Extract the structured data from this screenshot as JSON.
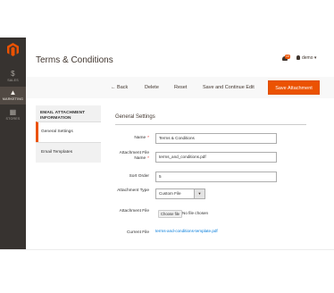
{
  "sidebar": {
    "items": [
      {
        "label": "SALES",
        "icon": "dollar-icon"
      },
      {
        "label": "MARKETING",
        "icon": "megaphone-icon"
      },
      {
        "label": "STORES",
        "icon": "store-icon"
      }
    ]
  },
  "header": {
    "title": "Terms & Conditions",
    "notification_count": "10",
    "user": "demo ▾"
  },
  "actions": {
    "back": "Back",
    "delete": "Delete",
    "reset": "Reset",
    "save_continue": "Save and Continue Edit",
    "save": "Save Attachment"
  },
  "tabs": {
    "title": "EMAIL ATTACHMENT INFORMATION",
    "items": [
      "General Settings",
      "Email Templates"
    ]
  },
  "form": {
    "section_title": "General Settings",
    "name_label": "Name",
    "name_value": "Terms & Conditions",
    "file_name_label": "Attachment File Name",
    "file_name_value": "terms_and_conditions.pdf",
    "sort_order_label": "Sort Order",
    "sort_order_value": "5",
    "type_label": "Attachment Type",
    "type_value": "Custom File",
    "file_label": "Attachment File",
    "choose_file": "Choose file",
    "no_file": "No file chosen",
    "current_file_label": "Current File",
    "current_file_value": "terms-and-conditions-template.pdf"
  },
  "colors": {
    "accent": "#eb5202",
    "sidebar": "#373330",
    "link": "#007bdb"
  }
}
